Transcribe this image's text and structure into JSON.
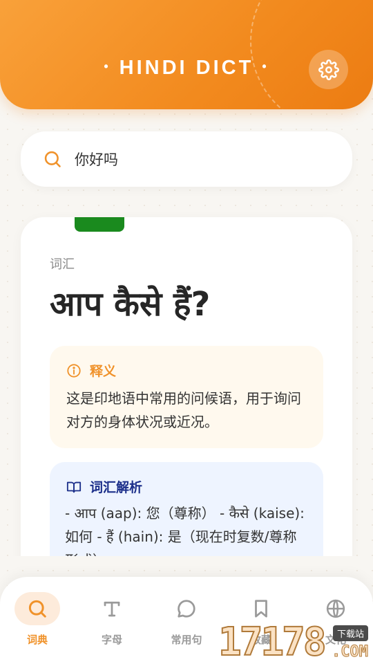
{
  "header": {
    "title": "HINDI DICT",
    "dot_left": "•",
    "dot_right": "•",
    "settings_icon": "gear-icon",
    "accent_color": "#f28a1e"
  },
  "search": {
    "icon": "search-icon",
    "value": "你好吗"
  },
  "entry": {
    "category": "词汇",
    "headword": "आप कैसे हैं?",
    "tag_color": "#1a8a1e",
    "meaning": {
      "icon": "info-icon",
      "title": "释义",
      "text": "这是印地语中常用的问候语，用于询问对方的身体状况或近况。"
    },
    "vocab": {
      "icon": "book-icon",
      "title": "词汇解析",
      "text": "- आप (aap): 您（尊称） - कैसे (kaise): 如何 - हैं (hain): 是（现在时复数/尊称形式）"
    }
  },
  "bottom_nav": {
    "items": [
      {
        "label": "词典",
        "icon": "search-icon",
        "active": true
      },
      {
        "label": "字母",
        "icon": "text-icon",
        "active": false
      },
      {
        "label": "常用句",
        "icon": "chat-bubble-icon",
        "active": false
      },
      {
        "label": "收藏",
        "icon": "bookmark-icon",
        "active": false
      },
      {
        "label": "文化",
        "icon": "globe-icon",
        "active": false
      }
    ]
  },
  "watermark": {
    "number": "17178",
    "badge": "下载站",
    "domain": ".COM"
  }
}
